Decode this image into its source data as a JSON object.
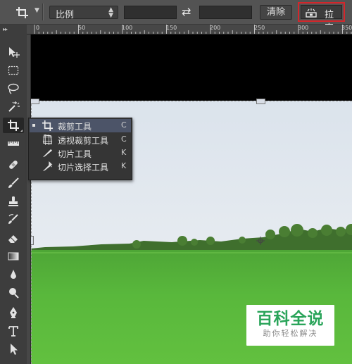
{
  "options_bar": {
    "crop_tool_icon": "crop-icon",
    "ratio_select_value": "比例",
    "width_field_value": "",
    "swap_icon": "swap-arrows-icon",
    "height_field_value": "",
    "clear_button_label": "清除",
    "straighten_button_label": "拉直",
    "straighten_icon": "level-icon"
  },
  "ruler": {
    "horizontal_labels": [
      "0",
      "50",
      "100",
      "150",
      "200",
      "250",
      "300",
      "350"
    ]
  },
  "toolbar": {
    "tools": [
      {
        "name": "move-tool",
        "icon": "move-icon",
        "active": false
      },
      {
        "name": "marquee-tool",
        "icon": "rect-marquee-icon",
        "active": false
      },
      {
        "name": "lasso-tool",
        "icon": "lasso-icon",
        "active": false
      },
      {
        "name": "magic-wand-tool",
        "icon": "magic-wand-icon",
        "active": false
      },
      {
        "name": "crop-tool",
        "icon": "crop-icon",
        "active": true
      },
      {
        "name": "ruler-tool",
        "icon": "ruler-icon",
        "active": false
      },
      {
        "name": "healing-brush-tool",
        "icon": "bandage-icon",
        "active": false
      },
      {
        "name": "brush-tool",
        "icon": "brush-icon",
        "active": false
      },
      {
        "name": "clone-stamp-tool",
        "icon": "stamp-icon",
        "active": false
      },
      {
        "name": "history-brush-tool",
        "icon": "history-brush-icon",
        "active": false
      },
      {
        "name": "eraser-tool",
        "icon": "eraser-icon",
        "active": false
      },
      {
        "name": "gradient-tool",
        "icon": "gradient-icon",
        "active": false
      },
      {
        "name": "blur-tool",
        "icon": "blur-drop-icon",
        "active": false
      },
      {
        "name": "dodge-tool",
        "icon": "dodge-icon",
        "active": false
      },
      {
        "name": "pen-tool",
        "icon": "pen-icon",
        "active": false
      },
      {
        "name": "type-tool",
        "icon": "type-icon",
        "active": false
      },
      {
        "name": "path-selection-tool",
        "icon": "arrow-select-icon",
        "active": false
      }
    ]
  },
  "crop_flyout": {
    "items": [
      {
        "label": "裁剪工具",
        "shortcut": "C",
        "icon": "crop-icon",
        "selected": true
      },
      {
        "label": "透视裁剪工具",
        "shortcut": "C",
        "icon": "perspective-crop-icon",
        "selected": false
      },
      {
        "label": "切片工具",
        "shortcut": "K",
        "icon": "slice-icon",
        "selected": false
      },
      {
        "label": "切片选择工具",
        "shortcut": "K",
        "icon": "slice-select-icon",
        "selected": false
      }
    ]
  },
  "watermark": {
    "title": "百科全说",
    "subtitle": "助你轻松解决"
  },
  "colors": {
    "highlight_border": "#d4262b",
    "flyout_selected": "#4c5468",
    "watermark_green": "#2aa45a",
    "sky": "#dfe6ee",
    "grass": "#55b33a"
  }
}
